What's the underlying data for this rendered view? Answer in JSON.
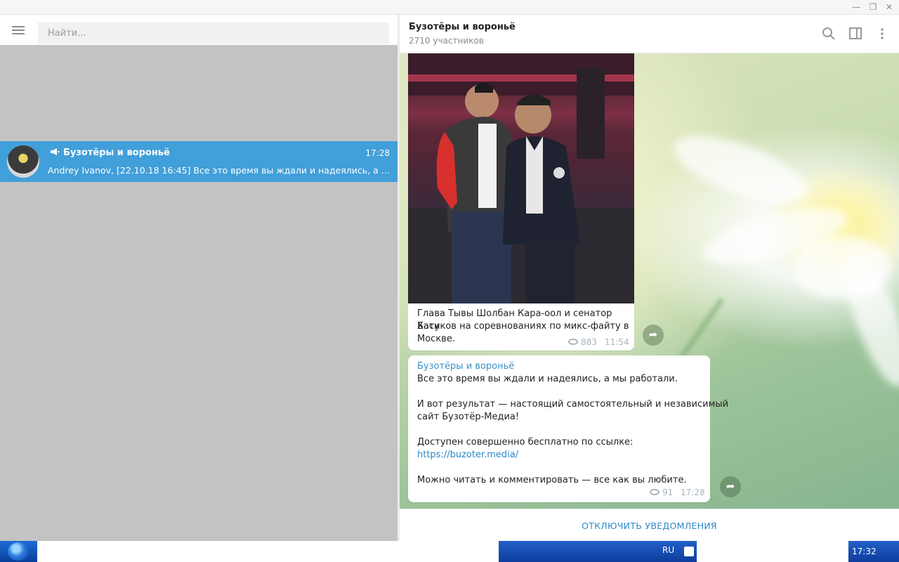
{
  "window": {
    "minimize_glyph": "—",
    "maximize_glyph": "❐",
    "close_glyph": "✕"
  },
  "sidebar": {
    "search_placeholder": "Найти...",
    "dialogs": [
      {
        "name": "Бузотёры и вороньё",
        "time": "17:28",
        "preview": "Andrey Ivanov, [22.10.18 16:45] Все это время вы ждали и надеялись, а мы раб...",
        "channel_icon": "megaphone-icon"
      }
    ]
  },
  "chat": {
    "title": "Бузотёры и вороньё",
    "subtitle": "2710 участников",
    "header_icons": [
      "search-icon",
      "sidebar-toggle-icon",
      "more-vertical-icon"
    ],
    "messages": [
      {
        "type": "photo",
        "caption_lines": [
          "Глава Тывы Шолбан Кара-оол и сенатор Бату",
          "Хасиков на соревнованиях по микс-файту в",
          "Москве."
        ],
        "views": "883",
        "time": "11:54"
      },
      {
        "type": "text",
        "author": "Бузотёры и вороньё",
        "lines": [
          "Все это время вы ждали и надеялись, а мы работали.",
          "И вот результат — настоящий самостоятельный и независимый",
          "сайт Бузотёр-Медиа!",
          "Доступен совершенно бесплатно по ссылке:",
          "Можно читать и комментировать — все как вы любите."
        ],
        "link": "https://buzoter.media/",
        "views": "91",
        "time": "17:28"
      }
    ],
    "mute_button": "ОТКЛЮЧИТЬ УВЕДОМЛЕНИЯ"
  },
  "taskbar": {
    "language": "RU",
    "clock": "17:32"
  },
  "colors": {
    "accent": "#419fd9",
    "link": "#2a87c7",
    "author": "#3a8fc7"
  }
}
